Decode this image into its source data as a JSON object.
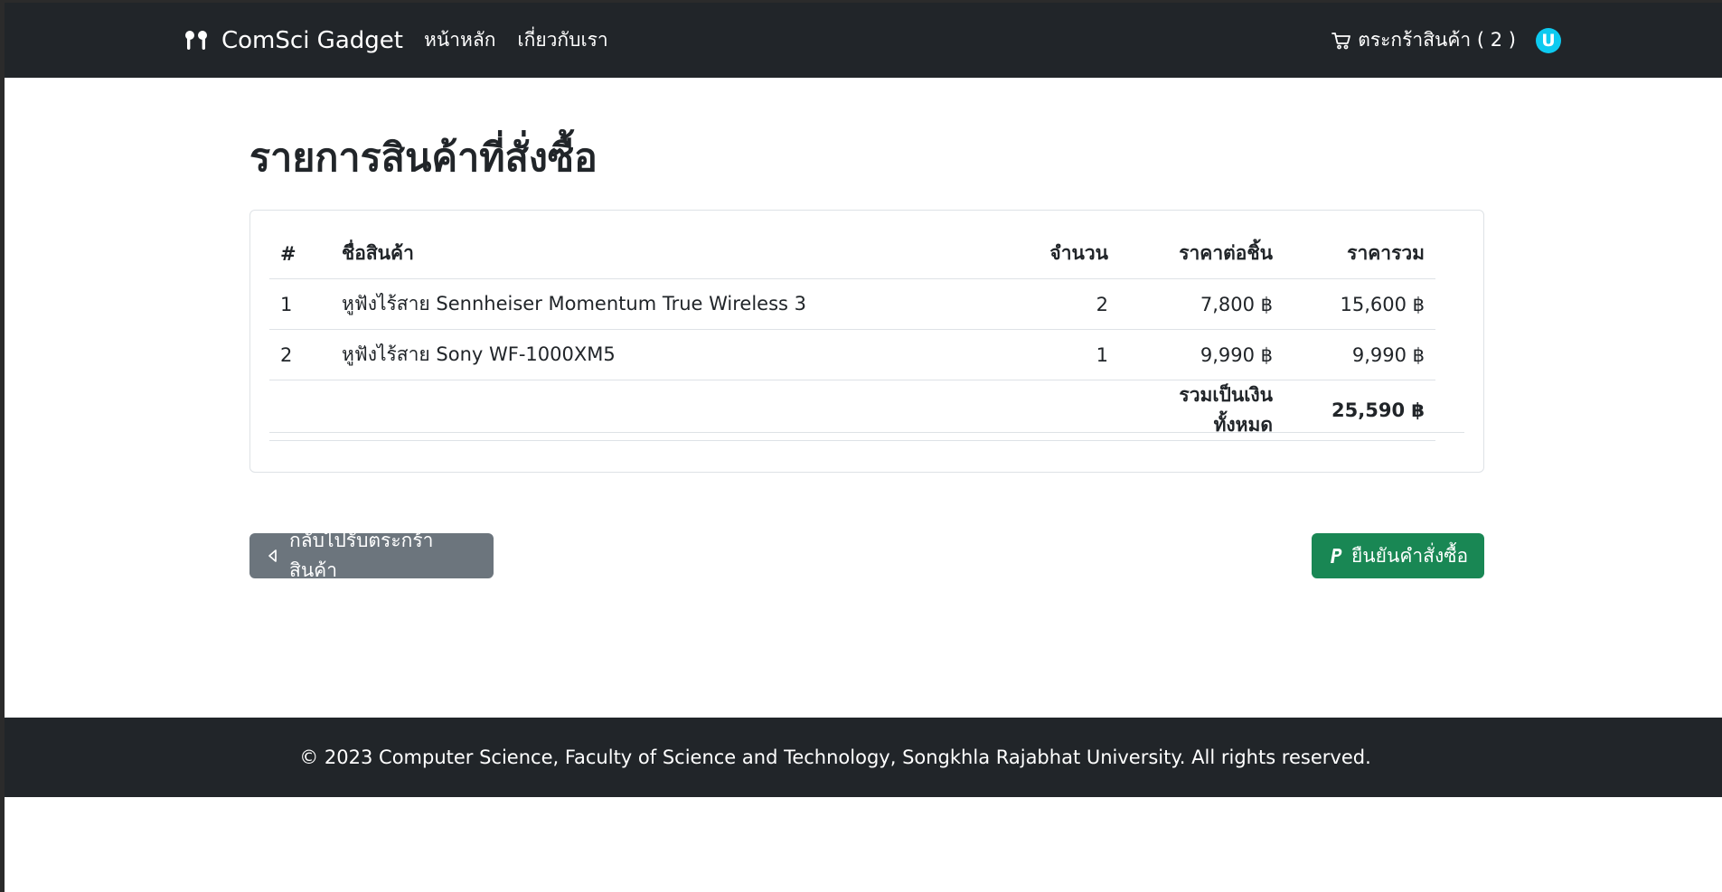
{
  "navbar": {
    "brand": "ComSci Gadget",
    "brand_icon": "earbuds-icon",
    "links": [
      "หน้าหลัก",
      "เกี่ยวกับเรา"
    ],
    "cart_label": "ตระกร้าสินค้า ( 2 )",
    "cart_icon": "cart-icon",
    "avatar_letter": "U",
    "bg_color": "#212529",
    "avatar_color": "#0dcaf0"
  },
  "main": {
    "title": "รายการสินค้าที่สั่งซื้อ",
    "table": {
      "headers": [
        "#",
        "ชื่อสินค้า",
        "จำนวน",
        "ราคาต่อชิ้น",
        "ราคารวม"
      ],
      "rows": [
        [
          "1",
          "หูฟังไร้สาย Sennheiser Momentum True Wireless 3",
          "2",
          "7,800 ฿",
          "15,600 ฿"
        ],
        [
          "2",
          "หูฟังไร้สาย Sony WF-1000XM5",
          "1",
          "9,990 ฿",
          "9,990 ฿"
        ]
      ],
      "total_label": "รวมเป็นเงินทั้งหมด",
      "total_value": "25,590 ฿"
    },
    "back_button": "กลับไปรับตระกร้าสินค้า",
    "back_icon": "caret-left-icon",
    "confirm_button": "ยืนยันคำสั่งซื้อ",
    "confirm_icon": "paypal-icon",
    "back_color": "#6c757d",
    "confirm_color": "#198754"
  },
  "footer": {
    "text": "© 2023 Computer Science, Faculty of Science and Technology, Songkhla Rajabhat University. All rights reserved."
  }
}
